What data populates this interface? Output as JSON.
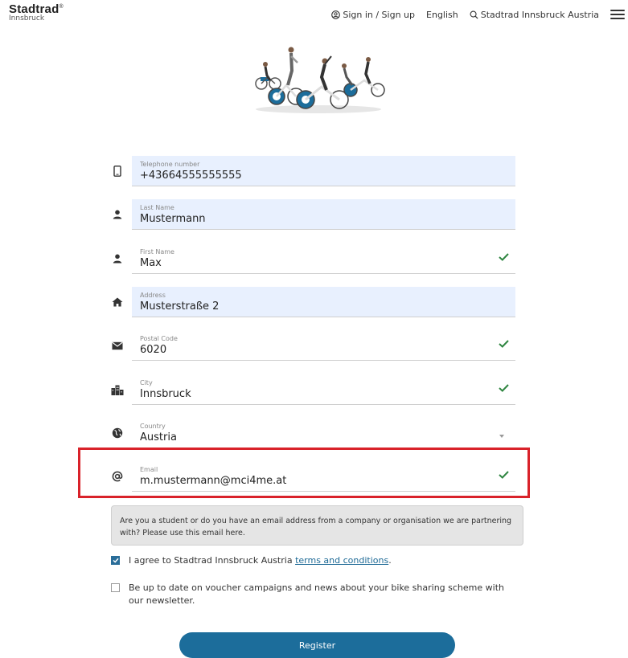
{
  "header": {
    "brand_name": "Stadtrad",
    "brand_mark": "®",
    "brand_city": "Innsbruck",
    "signin_label": "Sign in / Sign up",
    "language_label": "English",
    "search_label": "Stadtrad Innsbruck Austria",
    "icons": {
      "signin": "user-circle-icon",
      "search": "search-icon",
      "menu": "hamburger-menu-icon"
    }
  },
  "illustration": {
    "name": "cyclists-illustration"
  },
  "form": {
    "fields": [
      {
        "label": "Telephone number",
        "value": "+43664555555555",
        "icon": "phone-icon",
        "filled": true,
        "valid": false
      },
      {
        "label": "Last Name",
        "value": "Mustermann",
        "icon": "person-icon",
        "filled": true,
        "valid": false
      },
      {
        "label": "First Name",
        "value": "Max",
        "icon": "person-icon",
        "filled": false,
        "valid": true
      },
      {
        "label": "Address",
        "value": "Musterstraße 2",
        "icon": "home-icon",
        "filled": true,
        "valid": false
      },
      {
        "label": "Postal Code",
        "value": "6020",
        "icon": "envelope-icon",
        "filled": false,
        "valid": true
      },
      {
        "label": "City",
        "value": "Innsbruck",
        "icon": "city-icon",
        "filled": false,
        "valid": true
      },
      {
        "label": "Country",
        "value": "Austria",
        "icon": "globe-icon",
        "filled": false,
        "valid": false
      },
      {
        "label": "Email",
        "value": "m.mustermann@mci4me.at",
        "icon": "at-icon",
        "filled": false,
        "valid": true
      }
    ],
    "email_note": "Are you a student or do you have an email address from a company or organisation we are partnering with? Please use this email here.",
    "terms": {
      "checked": true,
      "text_before": "I agree to Stadtrad Innsbruck Austria ",
      "link": "terms and conditions",
      "text_after": "."
    },
    "newsletter": {
      "checked": false,
      "text": "Be up to date on voucher campaigns and news about your bike sharing scheme with our newsletter."
    },
    "register_label": "Register"
  },
  "colors": {
    "accent": "#1c6d9b",
    "check": "#2e8540",
    "highlight": "#d9222a",
    "autofill": "#e8f0fe"
  }
}
